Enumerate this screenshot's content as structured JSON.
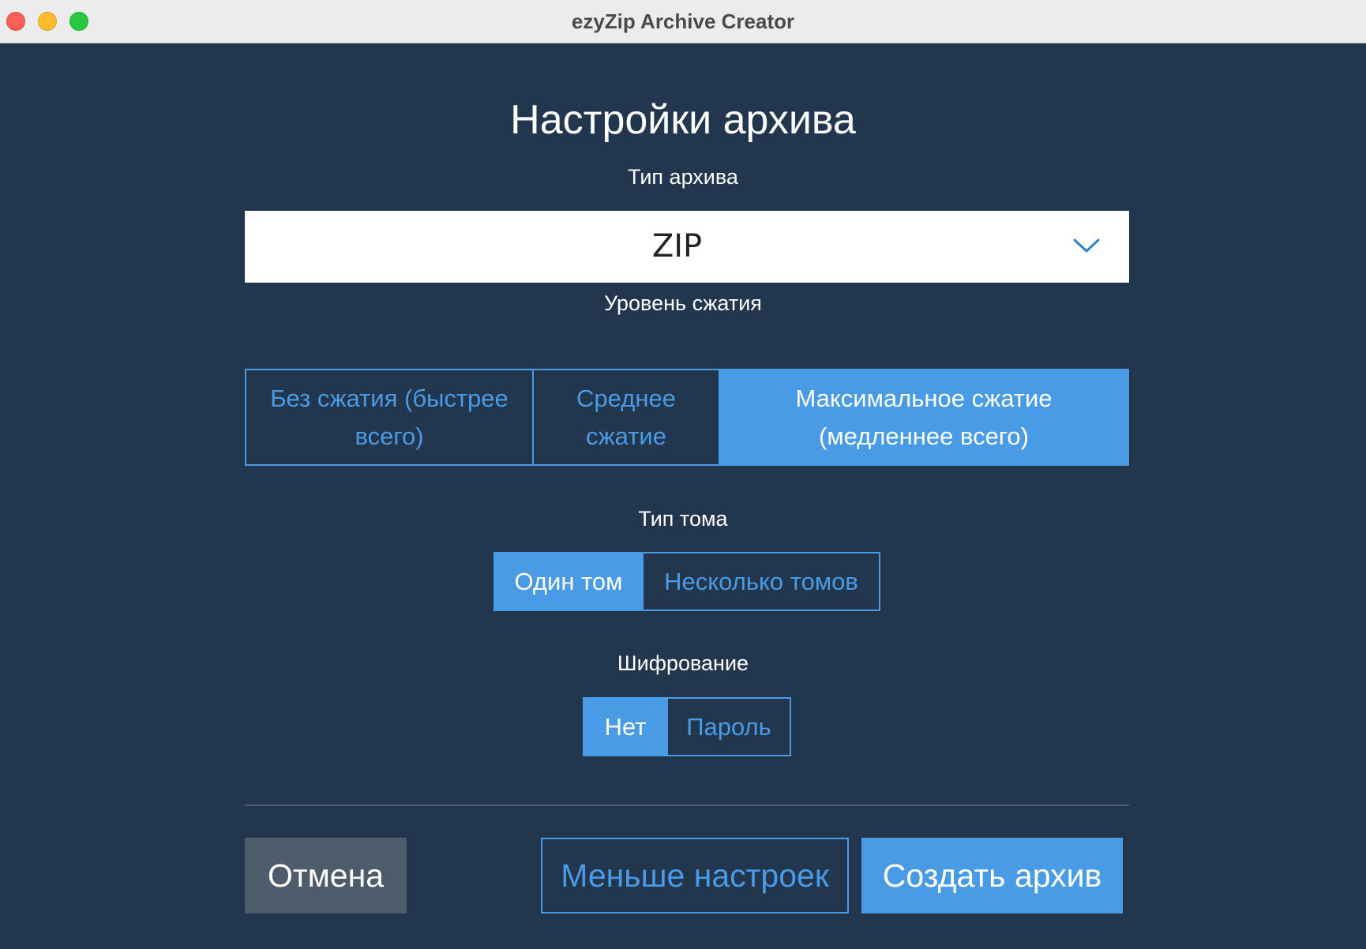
{
  "window": {
    "title": "ezyZip Archive Creator"
  },
  "page": {
    "title": "Настройки архива"
  },
  "archive_type": {
    "label": "Тип архива",
    "selected": "ZIP"
  },
  "compression": {
    "label": "Уровень сжатия",
    "options": [
      {
        "label": "Без сжатия (быстрее всего)",
        "active": false
      },
      {
        "label": "Среднее сжатие",
        "active": false
      },
      {
        "label": "Максимальное сжатие (медленнее всего)",
        "active": true
      }
    ]
  },
  "volume": {
    "label": "Тип тома",
    "options": [
      {
        "label": "Один том",
        "active": true
      },
      {
        "label": "Несколько томов",
        "active": false
      }
    ]
  },
  "encryption": {
    "label": "Шифрование",
    "options": [
      {
        "label": "Нет",
        "active": true
      },
      {
        "label": "Пароль",
        "active": false
      }
    ]
  },
  "buttons": {
    "cancel": "Отмена",
    "fewer_settings": "Меньше настроек",
    "create": "Создать архив"
  },
  "colors": {
    "background": "#22364d",
    "accent": "#4a9be6",
    "cancel_button": "#4d5c6b"
  },
  "icons": {
    "select_arrow": "chevron-down-icon"
  }
}
